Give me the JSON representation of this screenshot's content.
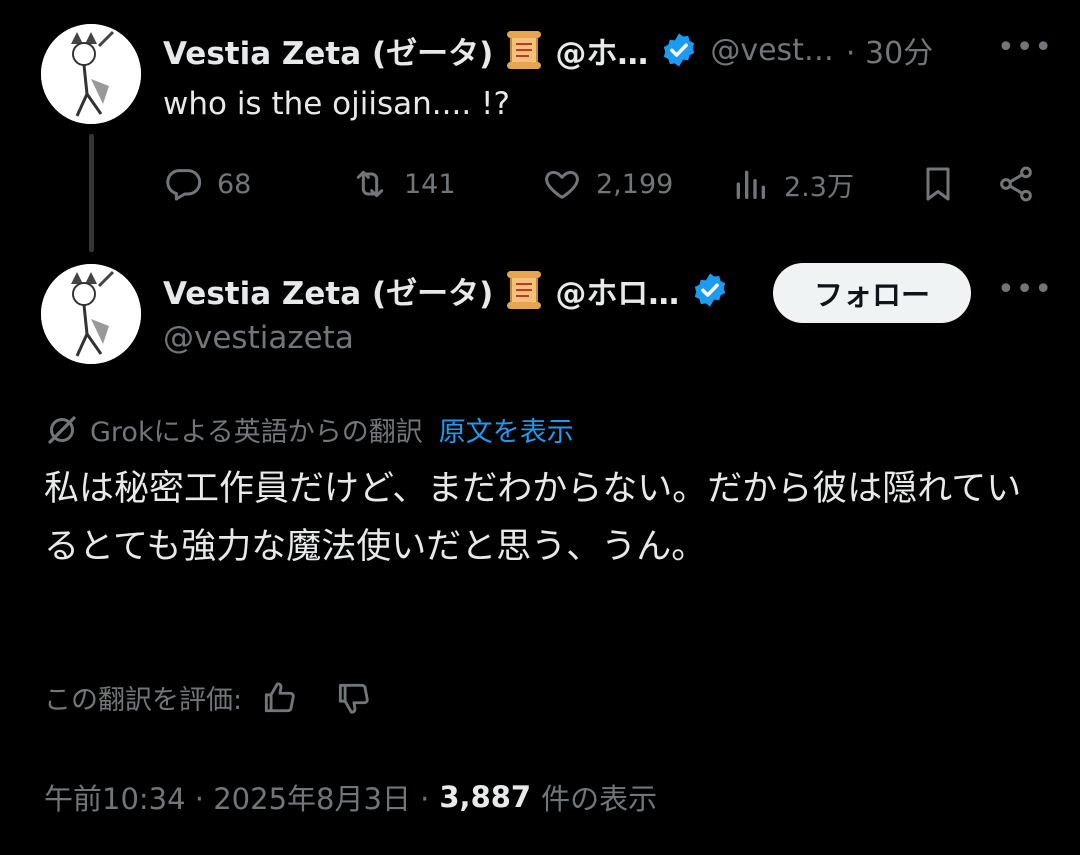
{
  "tweet1": {
    "display_name": "Vestia Zeta (ゼータ)",
    "handle_short": "@ホ…",
    "username": "@vest…",
    "time": "· 30分",
    "text": "who is the ojiisan.... !?",
    "stats": {
      "replies": "68",
      "retweets": "141",
      "likes": "2,199",
      "views": "2.3万"
    },
    "more": "•••"
  },
  "tweet2": {
    "display_name": "Vestia Zeta (ゼータ)",
    "handle_short": "@ホロ…",
    "username": "@vestiazeta",
    "follow_label": "フォロー",
    "more": "•••",
    "translation_note": "Grokによる英語からの翻訳",
    "show_original": "原文を表示",
    "translated_text": "私は秘密工作員だけど、まだわからない。だから彼は隠れているとても強力な魔法使いだと思う、うん。",
    "rate_label": "この翻訳を評価:",
    "timestamp": "午前10:34 · 2025年8月3日 ·",
    "view_count": "3,887",
    "view_suffix": "件の表示"
  },
  "colors": {
    "background": "#000000",
    "text": "#e7e9ea",
    "muted": "#71767b",
    "link": "#1d9bf0",
    "verified": "#1d9bf0"
  }
}
